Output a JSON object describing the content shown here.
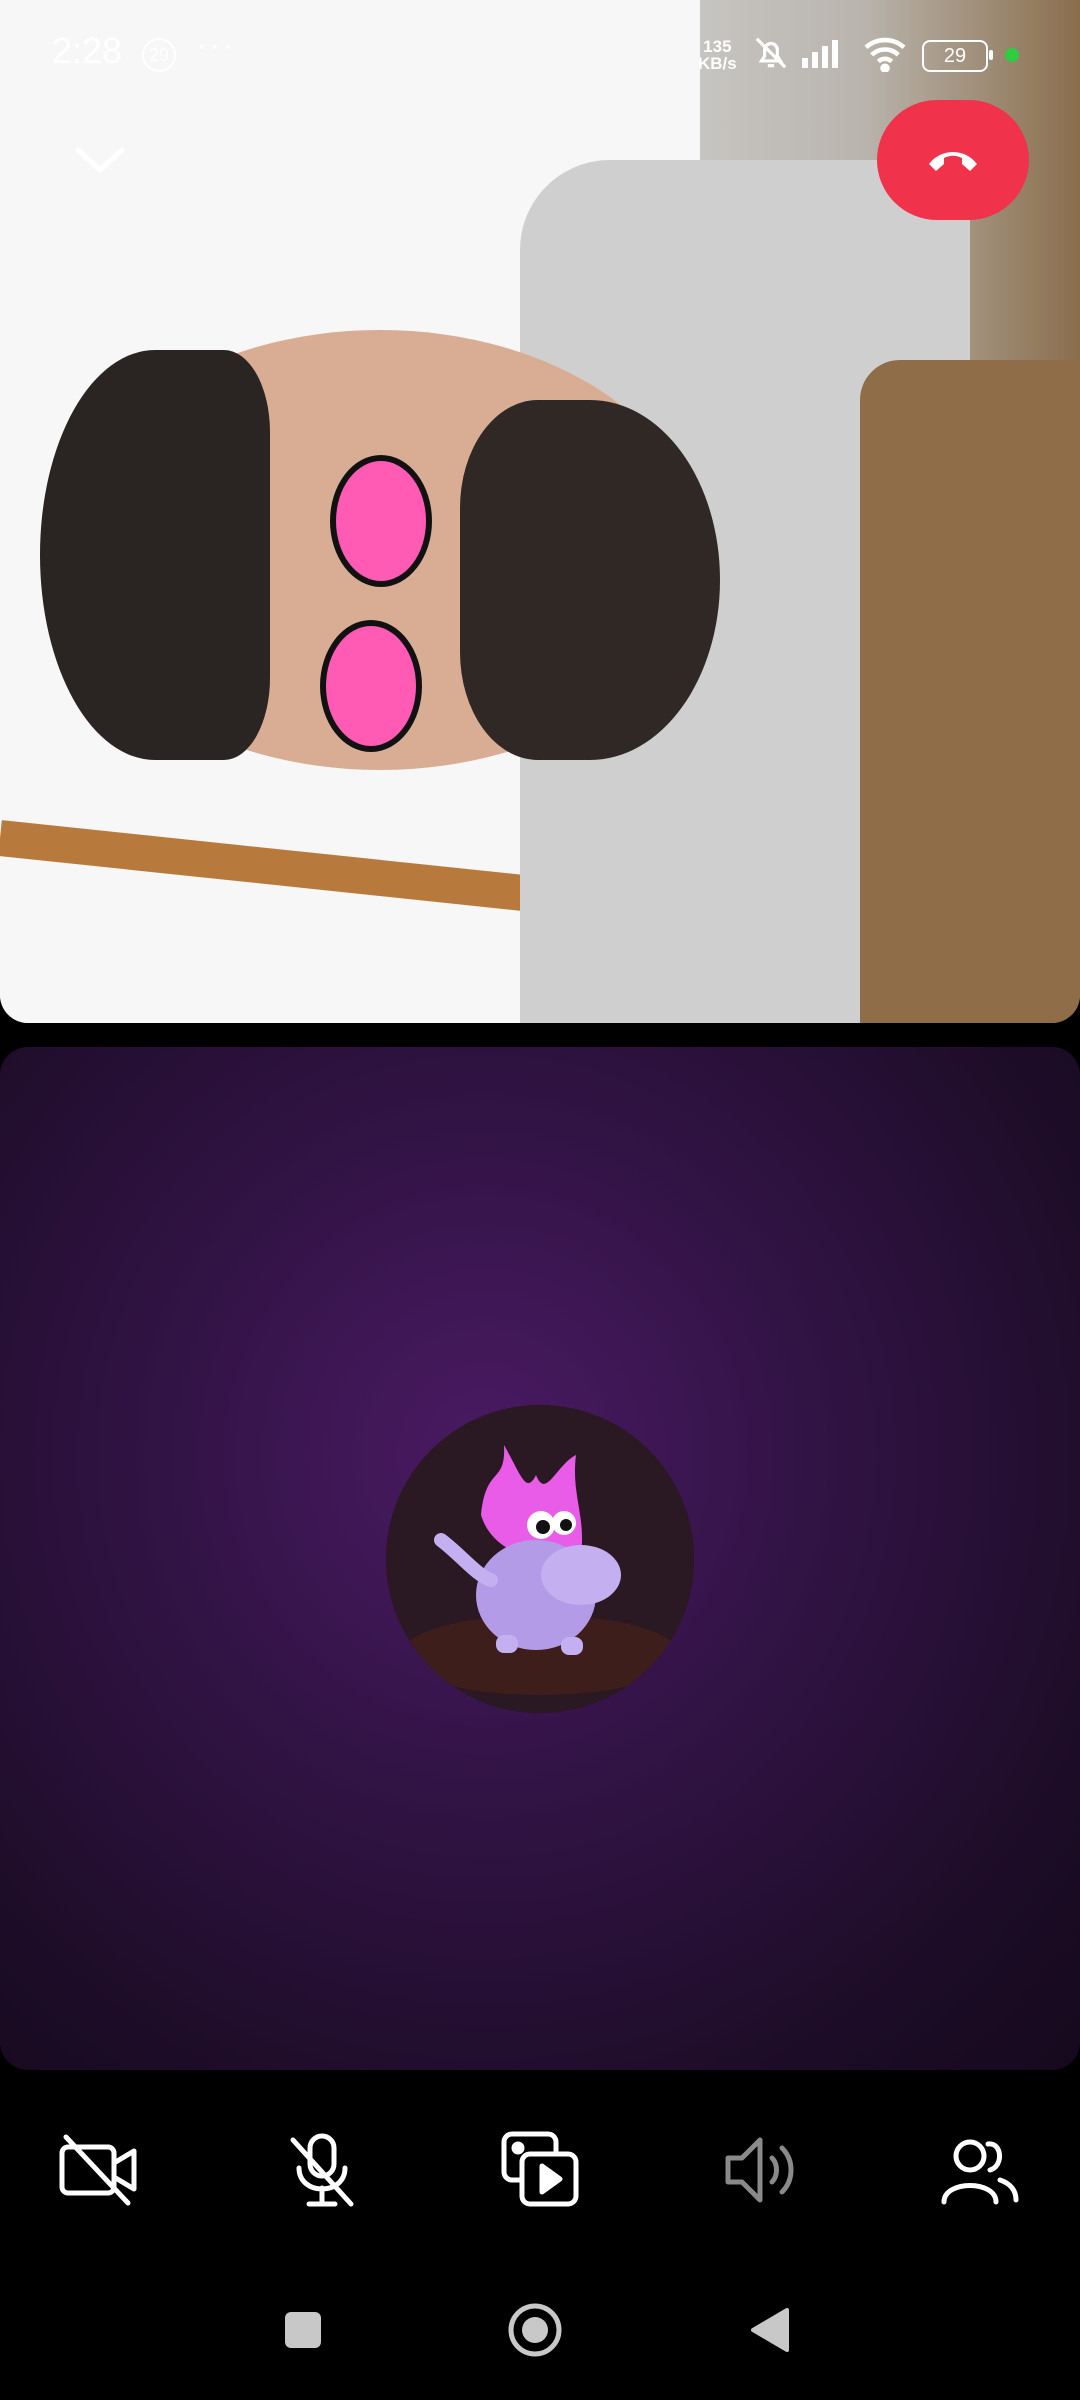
{
  "status_bar": {
    "time": "2:28",
    "notification_count": "29",
    "more": "···",
    "net_speed_value": "135",
    "net_speed_unit": "KB/s",
    "battery_level": "29",
    "icons": [
      "notifications-off-icon",
      "signal-icon",
      "wifi-icon",
      "battery-icon"
    ],
    "active_dot_color": "#2ecc40"
  },
  "call": {
    "end_call_color": "#f0324b",
    "collapse_icon": "chevron-down-icon"
  },
  "controls": [
    {
      "name": "camera-off-button",
      "icon": "video-off-icon"
    },
    {
      "name": "mute-button",
      "icon": "mic-off-icon"
    },
    {
      "name": "media-button",
      "icon": "media-share-icon"
    },
    {
      "name": "speaker-button",
      "icon": "speaker-icon"
    },
    {
      "name": "participants-button",
      "icon": "people-icon"
    }
  ],
  "nav": [
    "recents-button",
    "home-button",
    "back-button"
  ]
}
